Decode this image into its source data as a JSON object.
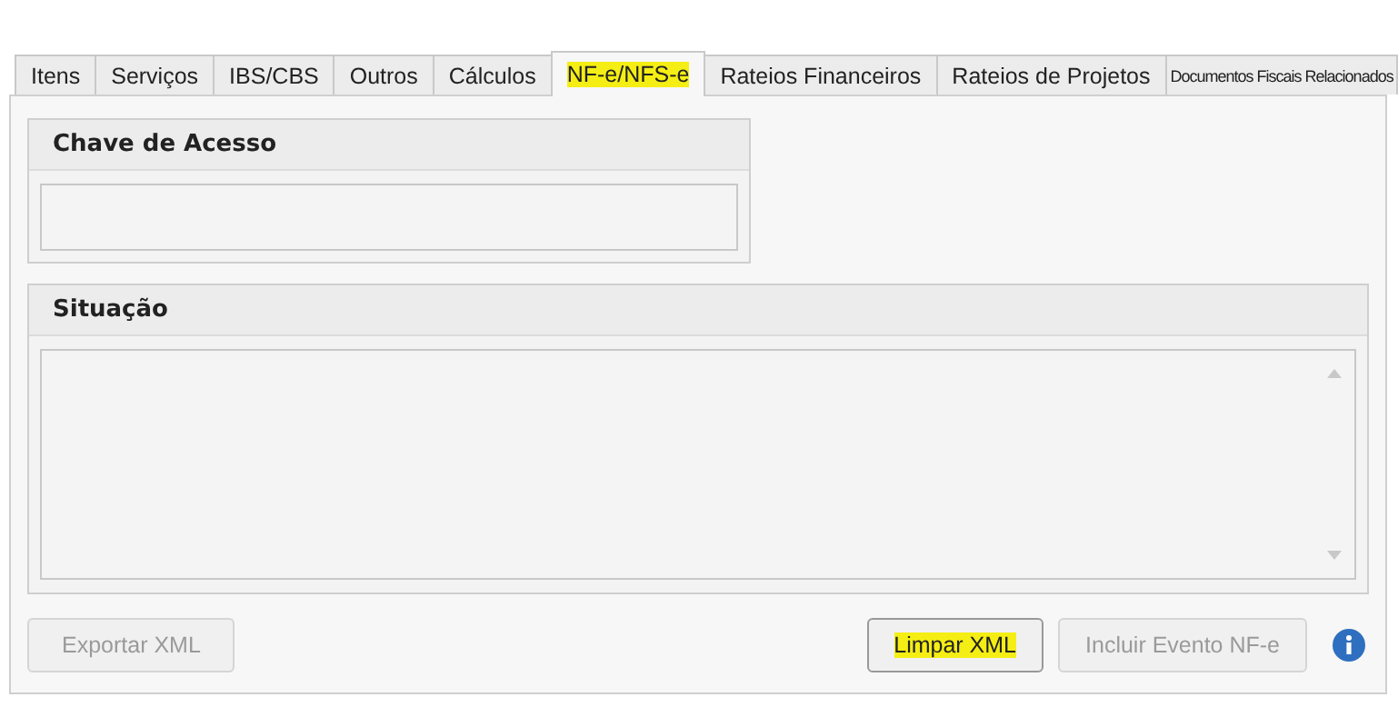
{
  "tabs": [
    {
      "label": "Itens",
      "selected": false,
      "highlighted": false
    },
    {
      "label": "Serviços",
      "selected": false,
      "highlighted": false
    },
    {
      "label": "IBS/CBS",
      "selected": false,
      "highlighted": false
    },
    {
      "label": "Outros",
      "selected": false,
      "highlighted": false
    },
    {
      "label": "Cálculos",
      "selected": false,
      "highlighted": false
    },
    {
      "label": "NF-e/NFS-e",
      "selected": true,
      "highlighted": true
    },
    {
      "label": "Rateios Financeiros",
      "selected": false,
      "highlighted": false
    },
    {
      "label": "Rateios de Projetos",
      "selected": false,
      "highlighted": false
    },
    {
      "label": "Documentos Fiscais Relacionados",
      "selected": false,
      "highlighted": false,
      "small": true
    }
  ],
  "access_key": {
    "title": "Chave de Acesso"
  },
  "situation": {
    "title": "Situação"
  },
  "buttons": [
    {
      "label": "Exportar XML",
      "disabled": true,
      "highlighted": false
    },
    {
      "label": "Limpar XML",
      "disabled": false,
      "highlighted": true
    },
    {
      "label": "Incluir Evento NF-e",
      "disabled": true,
      "highlighted": false
    }
  ]
}
